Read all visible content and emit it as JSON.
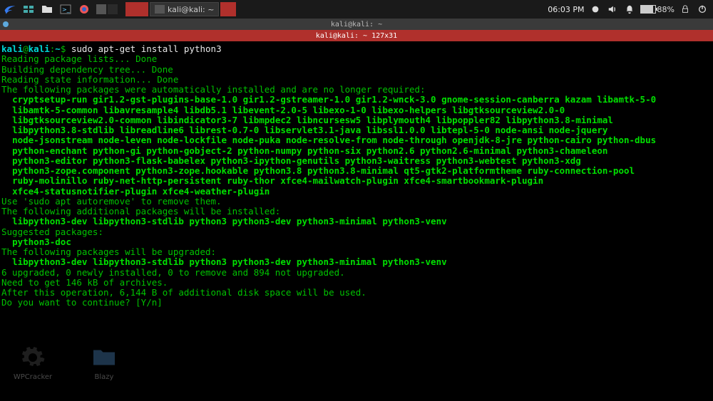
{
  "panel": {
    "task1_label": "",
    "task2_label": "kali@kali: ~",
    "clock": "06:03 PM",
    "battery_pct": "88%"
  },
  "window": {
    "title": "kali@kali: ~",
    "tab": "kali@kali: ~ 127x31"
  },
  "prompt": {
    "user": "kali",
    "at": "@",
    "host": "kali",
    "sep": ":",
    "cwd": "~",
    "sigil": "$ "
  },
  "cmd": "sudo apt-get install python3",
  "lines_plain": [
    "Reading package lists... Done",
    "Building dependency tree... Done",
    "Reading state information... Done",
    "The following packages were automatically installed and are no longer required:"
  ],
  "auto_pkgs": [
    "  cryptsetup-run gir1.2-gst-plugins-base-1.0 gir1.2-gstreamer-1.0 gir1.2-wnck-3.0 gnome-session-canberra kazam libamtk-5-0",
    "  libamtk-5-common libavresample4 libdb5.1 libevent-2.0-5 libexo-1-0 libexo-helpers libgtksourceview2.0-0",
    "  libgtksourceview2.0-common libindicator3-7 libmpdec2 libncursesw5 libplymouth4 libpoppler82 libpython3.8-minimal",
    "  libpython3.8-stdlib libreadline6 librest-0.7-0 libservlet3.1-java libssl1.0.0 libtepl-5-0 node-ansi node-jquery",
    "  node-jsonstream node-leven node-lockfile node-puka node-resolve-from node-through openjdk-8-jre python-cairo python-dbus",
    "  python-enchant python-gi python-gobject-2 python-numpy python-six python2.6 python2.6-minimal python3-chameleon",
    "  python3-editor python3-flask-babelex python3-ipython-genutils python3-waitress python3-webtest python3-xdg",
    "  python3-zope.component python3-zope.hookable python3.8 python3.8-minimal qt5-gtk2-platformtheme ruby-connection-pool",
    "  ruby-molinillo ruby-net-http-persistent ruby-thor xfce4-mailwatch-plugin xfce4-smartbookmark-plugin",
    "  xfce4-statusnotifier-plugin xfce4-weather-plugin"
  ],
  "lines_mid": [
    "Use 'sudo apt autoremove' to remove them.",
    "The following additional packages will be installed:"
  ],
  "add_pkgs": "  libpython3-dev libpython3-stdlib python3 python3-dev python3-minimal python3-venv",
  "lines_sugg_hdr": "Suggested packages:",
  "sugg_pkgs": "  python3-doc",
  "lines_upg_hdr": "The following packages will be upgraded:",
  "upg_pkgs": "  libpython3-dev libpython3-stdlib python3 python3-dev python3-minimal python3-venv",
  "lines_tail": [
    "6 upgraded, 0 newly installed, 0 to remove and 894 not upgraded.",
    "Need to get 146 kB of archives.",
    "After this operation, 6,144 B of additional disk space will be used.",
    "Do you want to continue? [Y/n] "
  ],
  "desktop": {
    "icon1": "WPCracker",
    "icon2": "Blazy"
  }
}
